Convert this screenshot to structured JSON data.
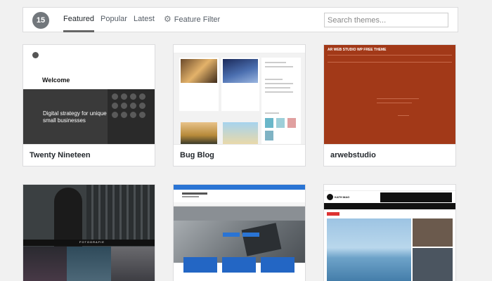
{
  "filter_bar": {
    "count": "15",
    "tabs": [
      "Featured",
      "Popular",
      "Latest"
    ],
    "feature_filter": "Feature Filter",
    "search_placeholder": "Search themes..."
  },
  "themes": [
    {
      "name": "Twenty Nineteen"
    },
    {
      "name": "Bug Blog"
    },
    {
      "name": "arwebstudio"
    },
    {
      "name": ""
    },
    {
      "name": ""
    },
    {
      "name": ""
    }
  ],
  "previews": {
    "twenty_nineteen": {
      "welcome": "Welcome",
      "tagline": "Digital strategy for unique small businesses"
    },
    "arwebstudio": {
      "title": "AR WEB STUDIO WP FREE THEME"
    },
    "fotografie": {
      "label": "FOTOGRAFIE"
    },
    "kath_mag": {
      "logo": "KATH MAG"
    }
  },
  "colors": {
    "accent": "#2a74d4",
    "ar_red": "#a23918"
  }
}
